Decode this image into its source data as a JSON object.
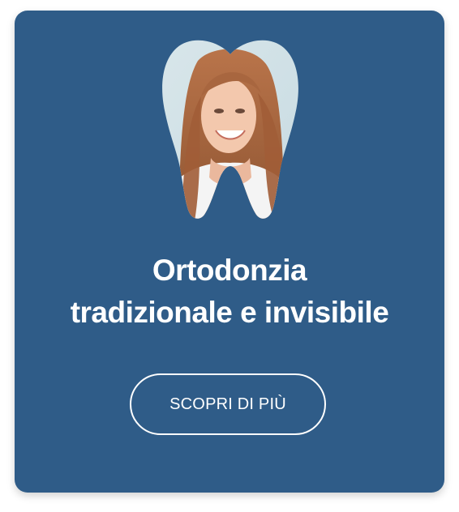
{
  "card": {
    "title_line1": "Ortodonzia",
    "title_line2": "tradizionale e invisibile",
    "button_label": "SCOPRI DI PIÙ"
  },
  "image": {
    "subject": "smiling-woman-photo",
    "shape": "tooth-icon"
  },
  "colors": {
    "card_background": "#2f5c88",
    "text": "#ffffff",
    "button_border": "#ffffff"
  }
}
